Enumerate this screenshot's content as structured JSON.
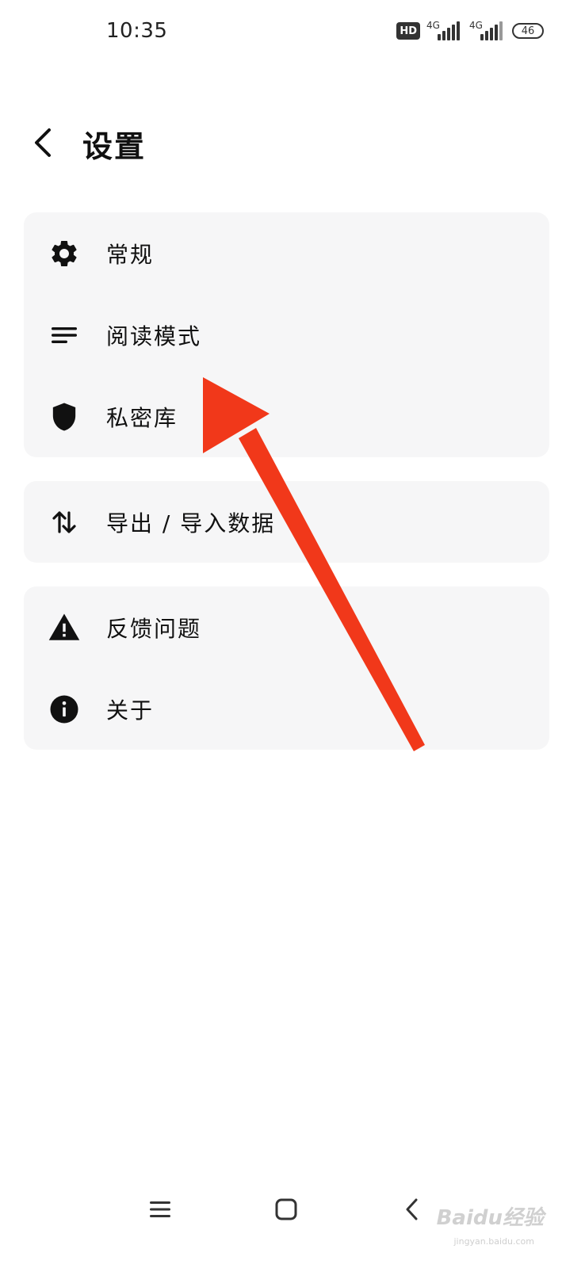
{
  "status_bar": {
    "time": "10:35",
    "hd_label": "HD",
    "network_1": "4G",
    "network_2": "4G",
    "battery": "46"
  },
  "header": {
    "title": "设置"
  },
  "groups": [
    {
      "items": [
        {
          "icon": "gear-icon",
          "label": "常规"
        },
        {
          "icon": "lines-icon",
          "label": "阅读模式"
        },
        {
          "icon": "shield-icon",
          "label": "私密库"
        }
      ]
    },
    {
      "items": [
        {
          "icon": "transfer-arrows-icon",
          "label": "导出 / 导入数据"
        }
      ]
    },
    {
      "items": [
        {
          "icon": "warning-icon",
          "label": "反馈问题"
        },
        {
          "icon": "info-icon",
          "label": "关于"
        }
      ]
    }
  ],
  "annotation": {
    "arrow_color": "#f1381a"
  },
  "colors": {
    "card_bg": "#f6f6f7",
    "text": "#111111"
  },
  "watermark": {
    "brand": "Baidu经验",
    "url": "jingyan.baidu.com"
  }
}
